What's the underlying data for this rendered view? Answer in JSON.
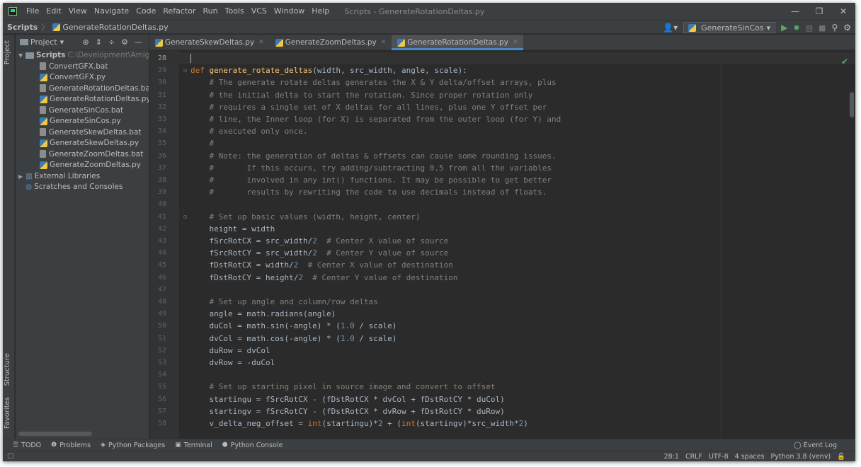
{
  "menu": [
    "File",
    "Edit",
    "View",
    "Navigate",
    "Code",
    "Refactor",
    "Run",
    "Tools",
    "VCS",
    "Window",
    "Help"
  ],
  "window_title": "Scripts - GenerateRotationDeltas.py",
  "breadcrumb": {
    "root": "Scripts",
    "file": "GenerateRotationDeltas.py"
  },
  "run_config": "GenerateSinCos",
  "project": {
    "label": "Project",
    "root": {
      "name": "Scripts",
      "path": "C:\\Development\\AmigaDev\\"
    },
    "files": [
      "ConvertGFX.bat",
      "ConvertGFX.py",
      "GenerateRotationDeltas.bat",
      "GenerateRotationDeltas.py",
      "GenerateSinCos.bat",
      "GenerateSinCos.py",
      "GenerateSkewDeltas.bat",
      "GenerateSkewDeltas.py",
      "GenerateZoomDeltas.bat",
      "GenerateZoomDeltas.py"
    ],
    "external": "External Libraries",
    "scratches": "Scratches and Consoles"
  },
  "side_tabs": {
    "project": "Project",
    "structure": "Structure",
    "favorites": "Favorites"
  },
  "tabs": [
    {
      "label": "GenerateSkewDeltas.py",
      "active": false
    },
    {
      "label": "GenerateZoomDeltas.py",
      "active": false
    },
    {
      "label": "GenerateRotationDeltas.py",
      "active": true
    }
  ],
  "code": [
    {
      "n": "28",
      "t": ""
    },
    {
      "n": "29",
      "t": "def generate_rotate_deltas(width, src_width, angle, scale):"
    },
    {
      "n": "30",
      "t": "    # The generate rotate deltas generates the X & Y delta/offset arrays, plus"
    },
    {
      "n": "31",
      "t": "    # the initial delta to start the rotation. Since proper rotation only"
    },
    {
      "n": "32",
      "t": "    # requires a single set of X deltas for all lines, plus one Y offset per"
    },
    {
      "n": "33",
      "t": "    # line, the Inner loop (for X) is separated from the outer loop (for Y) and"
    },
    {
      "n": "34",
      "t": "    # executed only once."
    },
    {
      "n": "35",
      "t": "    #"
    },
    {
      "n": "36",
      "t": "    # Note: the generation of deltas & offsets can cause some rounding issues."
    },
    {
      "n": "37",
      "t": "    #       If this occurs, try adding/subtracting 0.5 from all the variables"
    },
    {
      "n": "38",
      "t": "    #       involved in any int() functions. It may be possible to get better"
    },
    {
      "n": "39",
      "t": "    #       results by rewriting the code to use decimals instead of floats."
    },
    {
      "n": "40",
      "t": ""
    },
    {
      "n": "41",
      "t": "    # Set up basic values (width, height, center)"
    },
    {
      "n": "42",
      "t": "    height = width"
    },
    {
      "n": "43",
      "t": "    fSrcRotCX = src_width/2  # Center X value of source"
    },
    {
      "n": "44",
      "t": "    fSrcRotCY = src_width/2  # Center Y value of source"
    },
    {
      "n": "45",
      "t": "    fDstRotCX = width/2  # Center X value of destination"
    },
    {
      "n": "46",
      "t": "    fDstRotCY = height/2  # Center Y value of destination"
    },
    {
      "n": "47",
      "t": ""
    },
    {
      "n": "48",
      "t": "    # Set up angle and column/row deltas"
    },
    {
      "n": "49",
      "t": "    angle = math.radians(angle)"
    },
    {
      "n": "50",
      "t": "    duCol = math.sin(-angle) * (1.0 / scale)"
    },
    {
      "n": "51",
      "t": "    dvCol = math.cos(-angle) * (1.0 / scale)"
    },
    {
      "n": "52",
      "t": "    duRow = dvCol"
    },
    {
      "n": "53",
      "t": "    dvRow = -duCol"
    },
    {
      "n": "54",
      "t": ""
    },
    {
      "n": "55",
      "t": "    # Set up starting pixel in source image and convert to offset"
    },
    {
      "n": "56",
      "t": "    startingu = fSrcRotCX - (fDstRotCX * dvCol + fDstRotCY * duCol)"
    },
    {
      "n": "57",
      "t": "    startingv = fSrcRotCY - (fDstRotCX * dvRow + fDstRotCY * duRow)"
    },
    {
      "n": "58",
      "t": "    v_delta_neg_offset = int(startingu)*2 + (int(startingv)*src_width*2)"
    }
  ],
  "bottom_tools": [
    "TODO",
    "Problems",
    "Python Packages",
    "Terminal",
    "Python Console"
  ],
  "event_log": "Event Log",
  "status": {
    "position": "28:1",
    "line_sep": "CRLF",
    "encoding": "UTF-8",
    "indent": "4 spaces",
    "interpreter": "Python 3.8 (venv)"
  }
}
